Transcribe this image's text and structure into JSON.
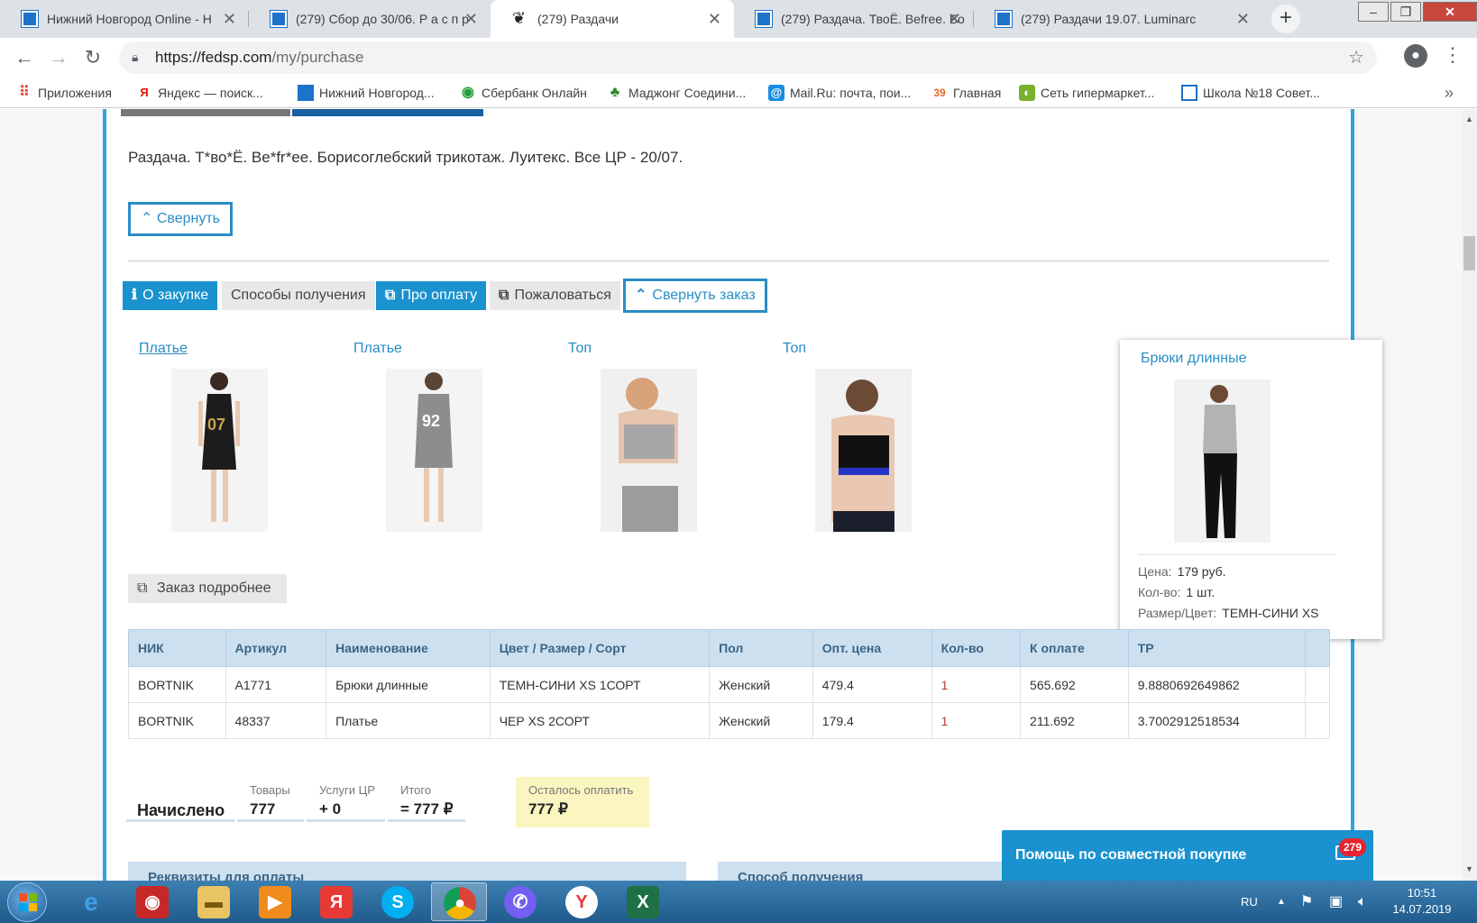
{
  "browser": {
    "tabs": [
      {
        "title": "Нижний Новгород Online - Н"
      },
      {
        "title": "(279) Сбор до 30/06. Р а с п р"
      },
      {
        "title": "(279) Раздачи"
      },
      {
        "title": "(279) Раздача. ТвоЁ. Befree. Бо"
      },
      {
        "title": "(279) Раздачи 19.07. Luminarc"
      }
    ],
    "url_base": "https://fedsp.com",
    "url_path": "/my/purchase",
    "bookmarks": [
      {
        "label": "Приложения"
      },
      {
        "label": "Яндекс — поиск..."
      },
      {
        "label": "Нижний Новгород..."
      },
      {
        "label": "Сбербанк Онлайн"
      },
      {
        "label": "Маджонг Соедини..."
      },
      {
        "label": "Mail.Ru: почта, пои..."
      },
      {
        "label": "Главная",
        "icon_text": "39"
      },
      {
        "label": "Сеть гипермаркет..."
      },
      {
        "label": "Школа №18 Совет..."
      }
    ],
    "bookmarks_more": "»"
  },
  "purchase": {
    "description": "Раздача. Т*во*Ё. Be*fr*ee. Борисоглебский трикотаж. Луитекс. Все ЦР - 20/07.",
    "collapse_label": "Свернуть",
    "actions": {
      "about": "О закупке",
      "delivery": "Способы получения",
      "payment": "Про оплату",
      "complain": "Пожаловаться",
      "collapse_order": "Свернуть заказ"
    },
    "products": [
      {
        "name": "Платье"
      },
      {
        "name": "Платье"
      },
      {
        "name": "Топ"
      },
      {
        "name": "Топ"
      },
      {
        "name": "Брюки длинные"
      }
    ],
    "popup": {
      "price_label": "Цена:",
      "price": "179 руб.",
      "qty_label": "Кол-во:",
      "qty": "1 шт.",
      "size_label": "Размер/Цвет:",
      "size": "ТЕМН-СИНИ XS"
    },
    "order_details_label": "Заказ подробнее"
  },
  "table": {
    "headers": [
      "НИК",
      "Артикул",
      "Наименование",
      "Цвет / Размер / Сорт",
      "Пол",
      "Опт. цена",
      "Кол-во",
      "К оплате",
      "ТР",
      ""
    ],
    "rows": [
      [
        "BORTNIK",
        "A1771",
        "Брюки длинные",
        "ТЕМН-СИНИ XS 1СОРТ",
        "Женский",
        "479.4",
        "1",
        "565.692",
        "9.8880692649862"
      ],
      [
        "BORTNIK",
        "48337",
        "Платье",
        "ЧЕР XS 2СОРТ",
        "Женский",
        "179.4",
        "1",
        "211.692",
        "3.7002912518534"
      ]
    ]
  },
  "summary": {
    "title": "Начислено",
    "goods_label": "Товары",
    "goods": "777",
    "services_label": "Услуги ЦР",
    "services": "+ 0",
    "total_label": "Итого",
    "total": "= 777 ₽",
    "due_label": "Осталось оплатить",
    "due": "777 ₽"
  },
  "panels": {
    "requisites": "Реквизиты для оплаты",
    "delivery": "Способ получения"
  },
  "help": {
    "label": "Помощь по совместной покупке",
    "badge": "279"
  },
  "taskbar": {
    "lang": "RU",
    "time": "10:51",
    "date": "14.07.2019"
  },
  "colors": {
    "accent": "#1a92cf",
    "frame": "#2ea3dc",
    "table_header": "#cde0f0",
    "due_bg": "#fbf5c0"
  }
}
